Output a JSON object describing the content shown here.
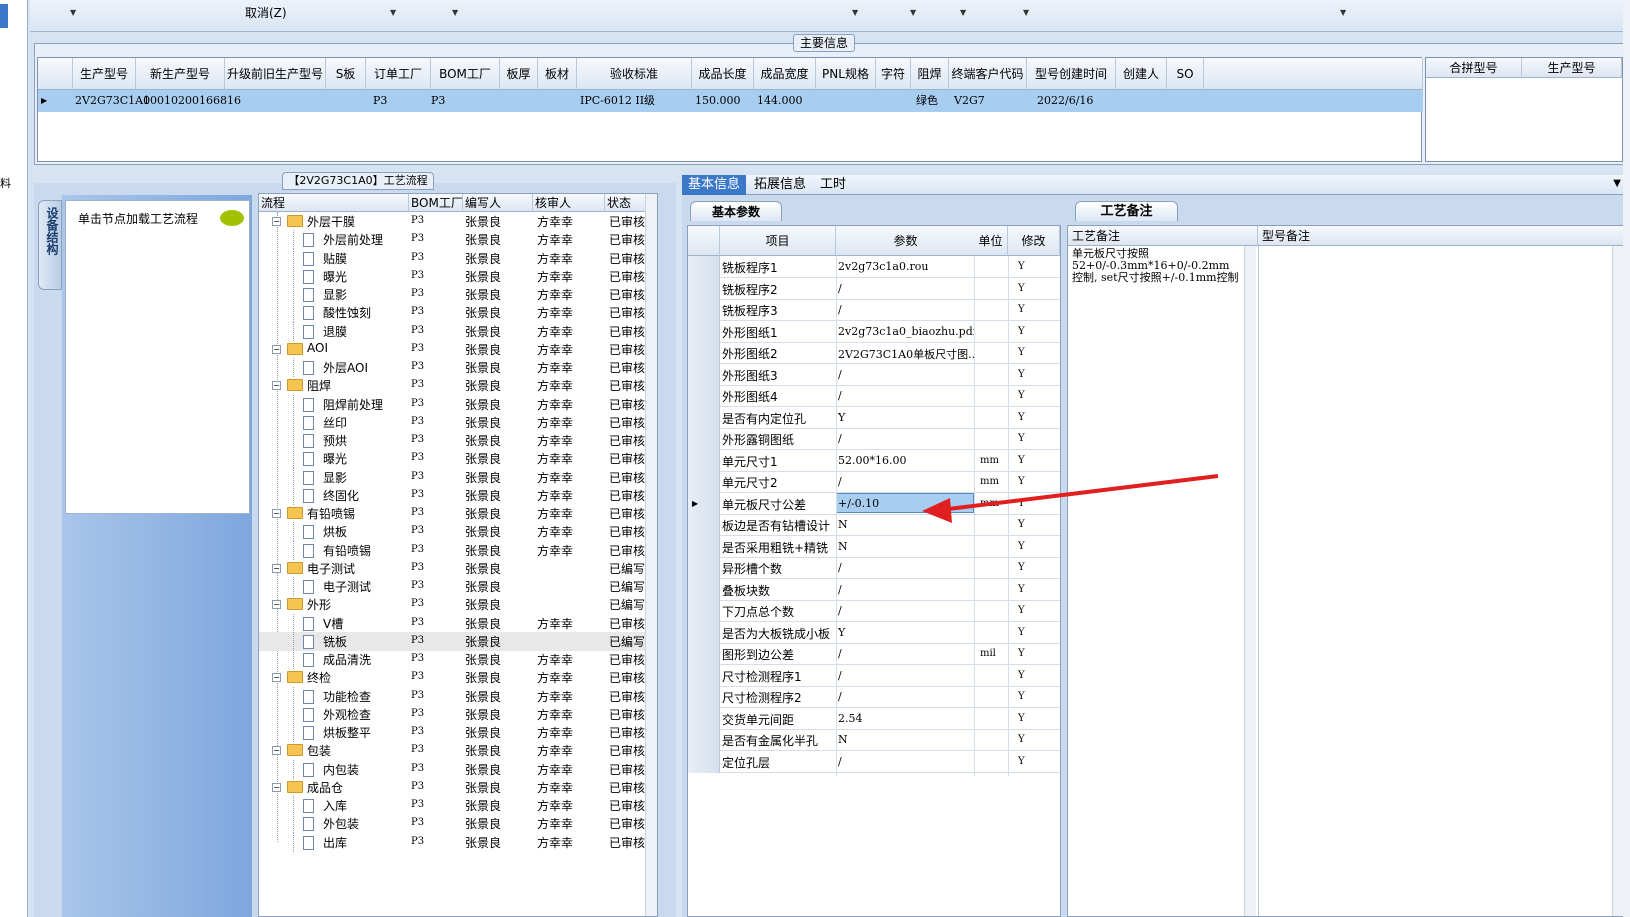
{
  "toolbar": {
    "cancel_label": "取消(Z)"
  },
  "main_info": {
    "title": "主要信息",
    "columns": [
      "生产型号",
      "新生产型号",
      "升级前旧生产型号",
      "S板",
      "订单工厂",
      "BOM工厂",
      "板厚",
      "板材",
      "验收标准",
      "成品长度",
      "成品宽度",
      "PNL规格",
      "字符",
      "阻焊",
      "终端客户代码",
      "型号创建时间",
      "创建人",
      "SO"
    ],
    "row": {
      "生产型号": "2V2G73C1A0",
      "新生产型号": "10010200166816",
      "订单工厂": "P3",
      "BOM工厂": "P3",
      "验收标准": "IPC-6012 II级",
      "成品长度": "150.000",
      "成品宽度": "144.000",
      "阻焊": "绿色",
      "终端客户代码": "V2G7",
      "型号创建时间": "2022/6/16"
    },
    "side_columns": [
      "合拼型号",
      "生产型号"
    ]
  },
  "process": {
    "tab_label": "【2V2G73C1A0】工艺流程",
    "vertical_tab": "设备结构",
    "load_hint": "单击节点加载工艺流程",
    "columns": [
      "流程",
      "BOM工厂",
      "编写人",
      "核审人",
      "状态"
    ],
    "rows": [
      {
        "name": "外层干膜",
        "type": "folder",
        "bom": "P3",
        "writer": "张景良",
        "reviewer": "方幸幸",
        "status": "已审核"
      },
      {
        "name": "外层前处理",
        "type": "file",
        "bom": "P3",
        "writer": "张景良",
        "reviewer": "方幸幸",
        "status": "已审核"
      },
      {
        "name": "贴膜",
        "type": "file",
        "bom": "P3",
        "writer": "张景良",
        "reviewer": "方幸幸",
        "status": "已审核"
      },
      {
        "name": "曝光",
        "type": "file",
        "bom": "P3",
        "writer": "张景良",
        "reviewer": "方幸幸",
        "status": "已审核"
      },
      {
        "name": "显影",
        "type": "file",
        "bom": "P3",
        "writer": "张景良",
        "reviewer": "方幸幸",
        "status": "已审核"
      },
      {
        "name": "酸性蚀刻",
        "type": "file",
        "bom": "P3",
        "writer": "张景良",
        "reviewer": "方幸幸",
        "status": "已审核"
      },
      {
        "name": "退膜",
        "type": "file",
        "bom": "P3",
        "writer": "张景良",
        "reviewer": "方幸幸",
        "status": "已审核"
      },
      {
        "name": "AOI",
        "type": "folder",
        "bom": "P3",
        "writer": "张景良",
        "reviewer": "方幸幸",
        "status": "已审核"
      },
      {
        "name": "外层AOI",
        "type": "file",
        "bom": "P3",
        "writer": "张景良",
        "reviewer": "方幸幸",
        "status": "已审核"
      },
      {
        "name": "阻焊",
        "type": "folder",
        "bom": "P3",
        "writer": "张景良",
        "reviewer": "方幸幸",
        "status": "已审核"
      },
      {
        "name": "阻焊前处理",
        "type": "file",
        "bom": "P3",
        "writer": "张景良",
        "reviewer": "方幸幸",
        "status": "已审核"
      },
      {
        "name": "丝印",
        "type": "file",
        "bom": "P3",
        "writer": "张景良",
        "reviewer": "方幸幸",
        "status": "已审核"
      },
      {
        "name": "预烘",
        "type": "file",
        "bom": "P3",
        "writer": "张景良",
        "reviewer": "方幸幸",
        "status": "已审核"
      },
      {
        "name": "曝光",
        "type": "file",
        "bom": "P3",
        "writer": "张景良",
        "reviewer": "方幸幸",
        "status": "已审核"
      },
      {
        "name": "显影",
        "type": "file",
        "bom": "P3",
        "writer": "张景良",
        "reviewer": "方幸幸",
        "status": "已审核"
      },
      {
        "name": "终固化",
        "type": "file",
        "bom": "P3",
        "writer": "张景良",
        "reviewer": "方幸幸",
        "status": "已审核"
      },
      {
        "name": "有铅喷锡",
        "type": "folder",
        "bom": "P3",
        "writer": "张景良",
        "reviewer": "方幸幸",
        "status": "已审核"
      },
      {
        "name": "烘板",
        "type": "file",
        "bom": "P3",
        "writer": "张景良",
        "reviewer": "方幸幸",
        "status": "已审核"
      },
      {
        "name": "有铅喷锡",
        "type": "file",
        "bom": "P3",
        "writer": "张景良",
        "reviewer": "方幸幸",
        "status": "已审核"
      },
      {
        "name": "电子测试",
        "type": "folder",
        "bom": "P3",
        "writer": "张景良",
        "reviewer": "",
        "status": "已编写"
      },
      {
        "name": "电子测试",
        "type": "file",
        "bom": "P3",
        "writer": "张景良",
        "reviewer": "",
        "status": "已编写"
      },
      {
        "name": "外形",
        "type": "folder",
        "bom": "P3",
        "writer": "张景良",
        "reviewer": "",
        "status": "已编写"
      },
      {
        "name": "V槽",
        "type": "file",
        "bom": "P3",
        "writer": "张景良",
        "reviewer": "方幸幸",
        "status": "已审核"
      },
      {
        "name": "铣板",
        "type": "file",
        "bom": "P3",
        "writer": "张景良",
        "reviewer": "",
        "status": "已编写"
      },
      {
        "name": "成品清洗",
        "type": "file",
        "bom": "P3",
        "writer": "张景良",
        "reviewer": "方幸幸",
        "status": "已审核"
      },
      {
        "name": "终检",
        "type": "folder",
        "bom": "P3",
        "writer": "张景良",
        "reviewer": "方幸幸",
        "status": "已审核"
      },
      {
        "name": "功能检查",
        "type": "file",
        "bom": "P3",
        "writer": "张景良",
        "reviewer": "方幸幸",
        "status": "已审核"
      },
      {
        "name": "外观检查",
        "type": "file",
        "bom": "P3",
        "writer": "张景良",
        "reviewer": "方幸幸",
        "status": "已审核"
      },
      {
        "name": "烘板整平",
        "type": "file",
        "bom": "P3",
        "writer": "张景良",
        "reviewer": "方幸幸",
        "status": "已审核"
      },
      {
        "name": "包装",
        "type": "folder",
        "bom": "P3",
        "writer": "张景良",
        "reviewer": "方幸幸",
        "status": "已审核"
      },
      {
        "name": "内包装",
        "type": "file",
        "bom": "P3",
        "writer": "张景良",
        "reviewer": "方幸幸",
        "status": "已审核"
      },
      {
        "name": "成品仓",
        "type": "folder",
        "bom": "P3",
        "writer": "张景良",
        "reviewer": "方幸幸",
        "status": "已审核"
      },
      {
        "name": "入库",
        "type": "file",
        "bom": "P3",
        "writer": "张景良",
        "reviewer": "方幸幸",
        "status": "已审核"
      },
      {
        "name": "外包装",
        "type": "file",
        "bom": "P3",
        "writer": "张景良",
        "reviewer": "方幸幸",
        "status": "已审核"
      },
      {
        "name": "出库",
        "type": "file",
        "bom": "P3",
        "writer": "张景良",
        "reviewer": "方幸幸",
        "status": "已审核"
      }
    ]
  },
  "detail_tabs": [
    "基本信息",
    "拓展信息",
    "工时"
  ],
  "params": {
    "subtab": "基本参数",
    "columns": [
      "项目",
      "参数",
      "单位",
      "修改"
    ],
    "rows": [
      {
        "item": "铣板程序1",
        "value": "2v2g73c1a0.rou",
        "unit": "",
        "mod": "Y"
      },
      {
        "item": "铣板程序2",
        "value": "/",
        "unit": "",
        "mod": "Y"
      },
      {
        "item": "铣板程序3",
        "value": "/",
        "unit": "",
        "mod": "Y"
      },
      {
        "item": "外形图纸1",
        "value": "2v2g73c1a0_biaozhu.pdf",
        "unit": "",
        "mod": "Y"
      },
      {
        "item": "外形图纸2",
        "value": "2V2G73C1A0单板尺寸图...",
        "unit": "",
        "mod": "Y"
      },
      {
        "item": "外形图纸3",
        "value": "/",
        "unit": "",
        "mod": "Y"
      },
      {
        "item": "外形图纸4",
        "value": "/",
        "unit": "",
        "mod": "Y"
      },
      {
        "item": "是否有内定位孔",
        "value": "Y",
        "unit": "",
        "mod": "Y"
      },
      {
        "item": "外形露铜图纸",
        "value": "/",
        "unit": "",
        "mod": "Y"
      },
      {
        "item": "单元尺寸1",
        "value": "52.00*16.00",
        "unit": "mm",
        "mod": "Y"
      },
      {
        "item": "单元尺寸2",
        "value": "/",
        "unit": "mm",
        "mod": "Y"
      },
      {
        "item": "单元板尺寸公差",
        "value": "+/-0.10",
        "unit": "mm",
        "mod": "Y"
      },
      {
        "item": "板边是否有钻槽设计",
        "value": "N",
        "unit": "",
        "mod": "Y"
      },
      {
        "item": "是否采用粗铣+精铣",
        "value": "N",
        "unit": "",
        "mod": "Y"
      },
      {
        "item": "异形槽个数",
        "value": "/",
        "unit": "",
        "mod": "Y"
      },
      {
        "item": "叠板块数",
        "value": "/",
        "unit": "",
        "mod": "Y"
      },
      {
        "item": "下刀点总个数",
        "value": "/",
        "unit": "",
        "mod": "Y"
      },
      {
        "item": "是否为大板铣成小板",
        "value": "Y",
        "unit": "",
        "mod": "Y"
      },
      {
        "item": "图形到边公差",
        "value": "/",
        "unit": "mil",
        "mod": "Y"
      },
      {
        "item": "尺寸检测程序1",
        "value": "/",
        "unit": "",
        "mod": "Y"
      },
      {
        "item": "尺寸检测程序2",
        "value": "/",
        "unit": "",
        "mod": "Y"
      },
      {
        "item": "交货单元间距",
        "value": "2.54",
        "unit": "",
        "mod": "Y"
      },
      {
        "item": "是否有金属化半孔",
        "value": "N",
        "unit": "",
        "mod": "Y"
      },
      {
        "item": "定位孔层",
        "value": "/",
        "unit": "",
        "mod": "Y"
      }
    ]
  },
  "notes": {
    "tab": "工艺备注",
    "col1": "工艺备注",
    "col2": "型号备注",
    "text": "单元板尺寸按照52+0/-0.3mm*16+0/-0.2mm控制, set尺寸按照+/-0.1mm控制"
  },
  "colors": {
    "selection": "#a7cdf0",
    "accent": "#3c78c8",
    "annotation_arrow": "#e02020"
  }
}
